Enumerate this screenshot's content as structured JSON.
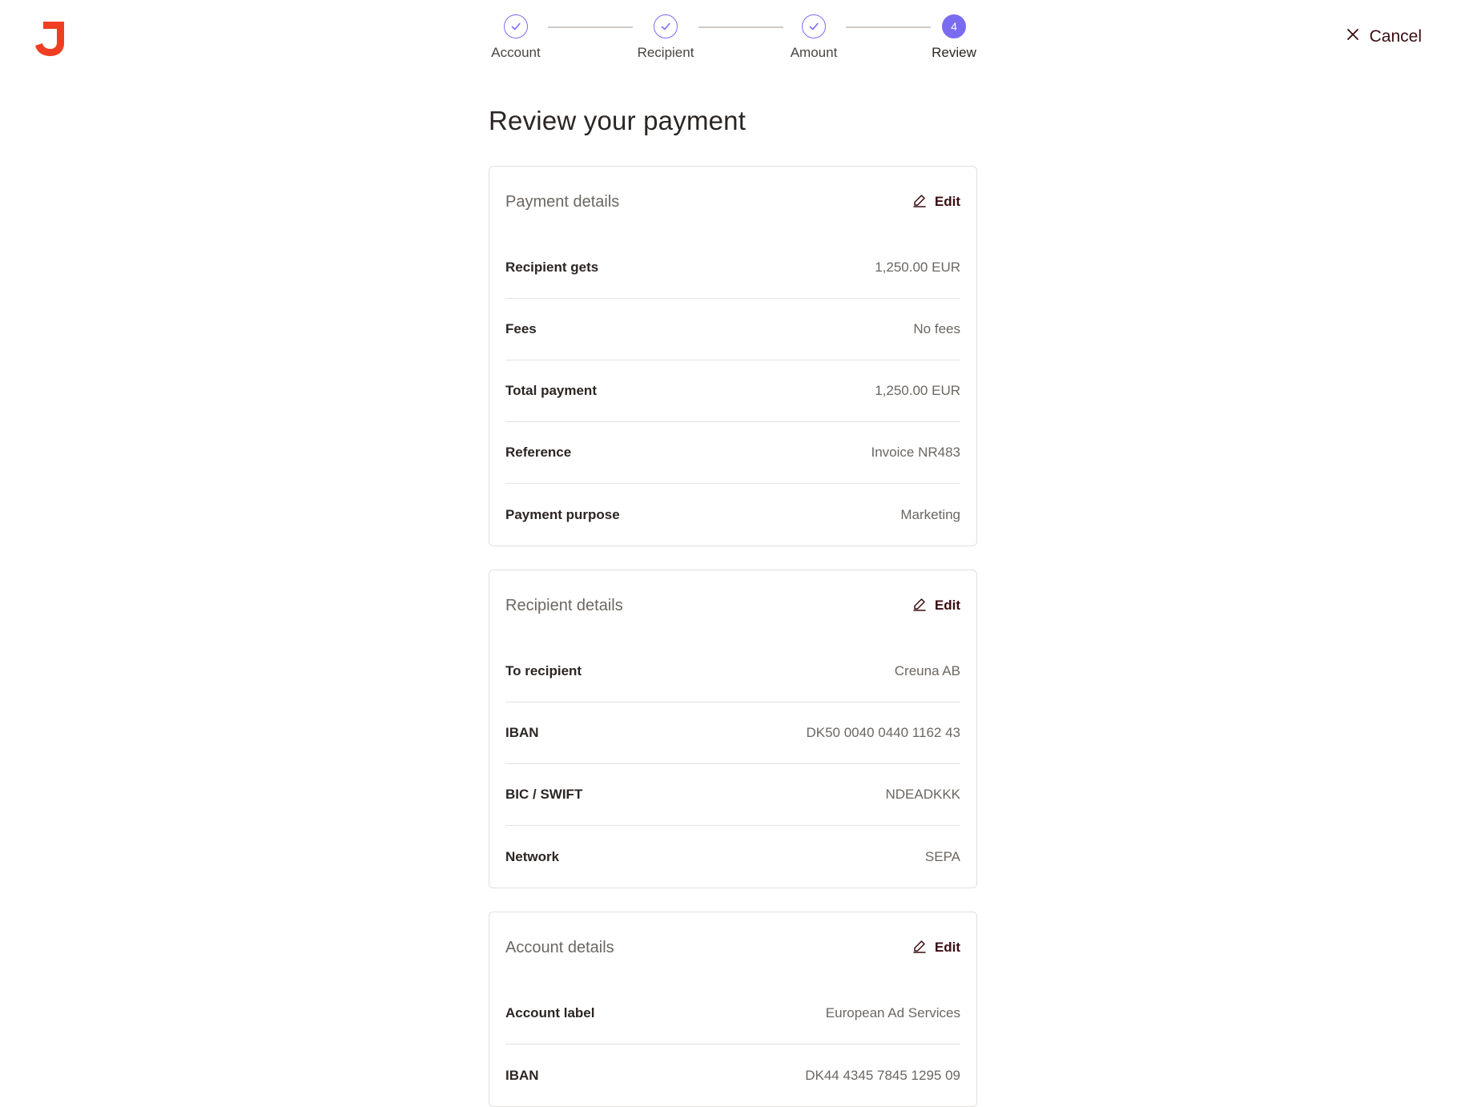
{
  "brand": {
    "logo_icon": "j-logo-icon",
    "logo_color": "#ef3e23"
  },
  "header": {
    "cancel_label": "Cancel",
    "cancel_icon": "close-icon"
  },
  "stepper": {
    "accent_color": "#7a6cf0",
    "current_step": 4,
    "steps": [
      {
        "label": "Account",
        "state": "completed",
        "icon": "check-icon"
      },
      {
        "label": "Recipient",
        "state": "completed",
        "icon": "check-icon"
      },
      {
        "label": "Amount",
        "state": "completed",
        "icon": "check-icon"
      },
      {
        "label": "Review",
        "state": "active",
        "number": "4"
      }
    ]
  },
  "page": {
    "title": "Review your payment"
  },
  "cards": [
    {
      "title": "Payment details",
      "edit_label": "Edit",
      "rows": [
        {
          "label": "Recipient gets",
          "value": "1,250.00 EUR"
        },
        {
          "label": "Fees",
          "value": "No fees"
        },
        {
          "label": "Total payment",
          "value": "1,250.00 EUR"
        },
        {
          "label": "Reference",
          "value": "Invoice NR483"
        },
        {
          "label": "Payment purpose",
          "value": "Marketing"
        }
      ]
    },
    {
      "title": "Recipient details",
      "edit_label": "Edit",
      "rows": [
        {
          "label": "To recipient",
          "value": "Creuna AB"
        },
        {
          "label": "IBAN",
          "value": "DK50 0040 0440 1162 43"
        },
        {
          "label": "BIC / SWIFT",
          "value": "NDEADKKK"
        },
        {
          "label": "Network",
          "value": "SEPA"
        }
      ]
    },
    {
      "title": "Account details",
      "edit_label": "Edit",
      "rows": [
        {
          "label": "Account label",
          "value": "European Ad Services"
        },
        {
          "label": "IBAN",
          "value": "DK44 4345 7845 1295 09"
        }
      ]
    }
  ]
}
